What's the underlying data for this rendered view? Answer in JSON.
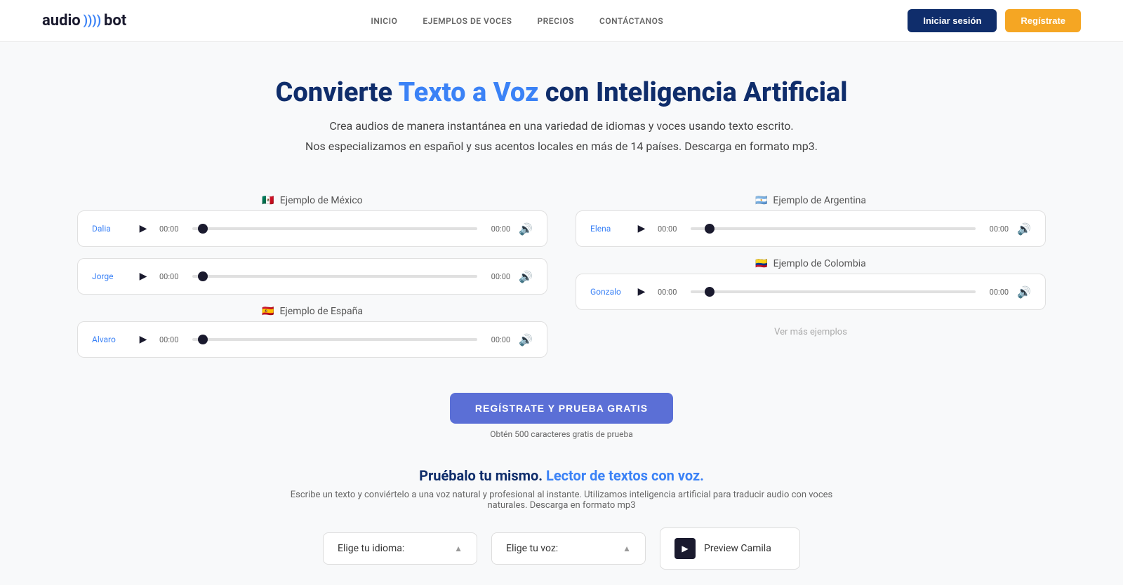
{
  "navbar": {
    "logo_audio": "audio",
    "logo_waves": "))))",
    "logo_bot": "bot",
    "nav_items": [
      {
        "label": "INICIO",
        "href": "#"
      },
      {
        "label": "EJEMPLOS DE VOCES",
        "href": "#"
      },
      {
        "label": "PRECIOS",
        "href": "#"
      },
      {
        "label": "CONTÁCTANOS",
        "href": "#"
      }
    ],
    "btn_login": "Iniciar sesión",
    "btn_register": "Regístrate"
  },
  "hero": {
    "title_part1": "Convierte ",
    "title_highlight": "Texto a Voz",
    "title_part2": " con Inteligencia Artificial",
    "subtitle1": "Crea audios de manera instantánea en una variedad de idiomas y voces usando texto escrito.",
    "subtitle2": "Nos especializamos en español y sus acentos locales en más de 14 países. Descarga en formato mp3."
  },
  "examples": {
    "mexico": {
      "flag": "🇲🇽",
      "label": "Ejemplo de México",
      "tracks": [
        {
          "name": "Dalia",
          "time_start": "00:00",
          "time_end": "00:00"
        },
        {
          "name": "Jorge",
          "time_start": "00:00",
          "time_end": "00:00"
        }
      ]
    },
    "spain": {
      "flag": "🇪🇸",
      "label": "Ejemplo de España",
      "tracks": [
        {
          "name": "Alvaro",
          "time_start": "00:00",
          "time_end": "00:00"
        }
      ]
    },
    "argentina": {
      "flag": "🇦🇷",
      "label": "Ejemplo de Argentina",
      "tracks": [
        {
          "name": "Elena",
          "time_start": "00:00",
          "time_end": "00:00"
        }
      ]
    },
    "colombia": {
      "flag": "🇨🇴",
      "label": "Ejemplo de Colombia",
      "tracks": [
        {
          "name": "Gonzalo",
          "time_start": "00:00",
          "time_end": "00:00"
        }
      ]
    },
    "ver_mas": "Ver más ejemplos"
  },
  "cta": {
    "button_label": "REGÍSTRATE Y PRUEBA GRATIS",
    "subtitle": "Obtén 500 caracteres gratis de prueba"
  },
  "try_section": {
    "title_part1": "Pruébalo tu mismo. ",
    "title_link": "Lector de textos con voz.",
    "subtitle": "Escribe un texto y conviértelo a una voz natural y profesional al instante. Utilizamos inteligencia artificial para traducir audio con voces naturales. Descarga en formato mp3"
  },
  "bottom_controls": {
    "language_label": "Elige tu idioma:",
    "voice_label": "Elige tu voz:",
    "preview_label": "Preview Camila"
  }
}
